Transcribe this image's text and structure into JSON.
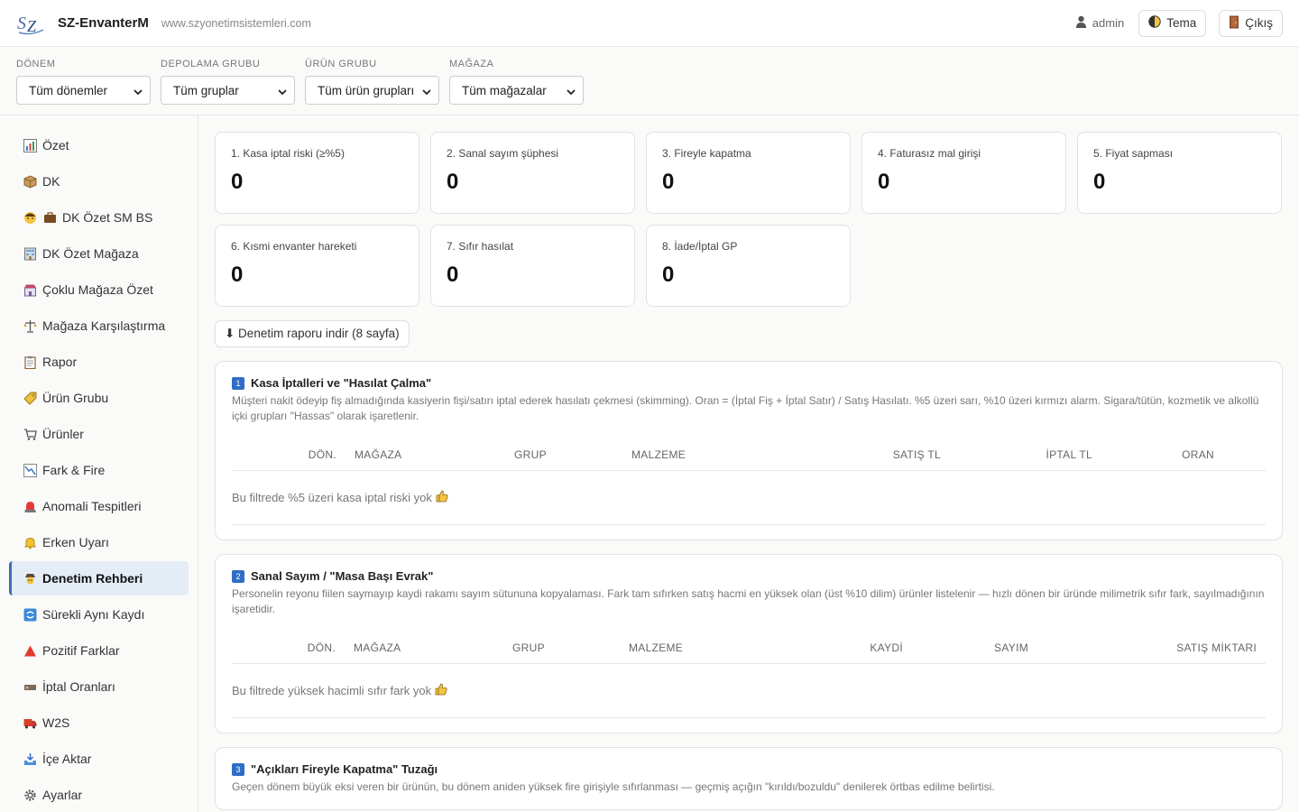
{
  "header": {
    "app_title": "SZ-EnvanterM",
    "site_url": "www.szyonetimsistemleri.com",
    "user": "admin",
    "theme_label": "Tema",
    "logout_label": "Çıkış"
  },
  "filters": [
    {
      "label": "DÖNEM",
      "value": "Tüm dönemler"
    },
    {
      "label": "DEPOLAMA GRUBU",
      "value": "Tüm gruplar"
    },
    {
      "label": "ÜRÜN GRUBU",
      "value": "Tüm ürün grupları"
    },
    {
      "label": "MAĞAZA",
      "value": "Tüm mağazalar"
    }
  ],
  "sidebar": {
    "items": [
      {
        "label": "Özet",
        "icon": "bar-chart-icon"
      },
      {
        "label": "DK",
        "icon": "package-icon"
      },
      {
        "label": "DK Özet SM BS",
        "icon": "person-briefcase-icon"
      },
      {
        "label": "DK Özet Mağaza",
        "icon": "building-icon"
      },
      {
        "label": "Çoklu Mağaza Özet",
        "icon": "store-icon"
      },
      {
        "label": "Mağaza Karşılaştırma",
        "icon": "scales-icon"
      },
      {
        "label": "Rapor",
        "icon": "clipboard-icon"
      },
      {
        "label": "Ürün Grubu",
        "icon": "tag-icon"
      },
      {
        "label": "Ürünler",
        "icon": "cart-icon"
      },
      {
        "label": "Fark & Fire",
        "icon": "trend-icon"
      },
      {
        "label": "Anomali Tespitleri",
        "icon": "siren-icon"
      },
      {
        "label": "Erken Uyarı",
        "icon": "bell-icon"
      },
      {
        "label": "Denetim Rehberi",
        "icon": "detective-icon"
      },
      {
        "label": "Sürekli Aynı Kaydı",
        "icon": "repeat-icon"
      },
      {
        "label": "Pozitif Farklar",
        "icon": "triangle-icon"
      },
      {
        "label": "İptal Oranları",
        "icon": "cancel-icon"
      },
      {
        "label": "W2S",
        "icon": "truck-icon"
      },
      {
        "label": "İçe Aktar",
        "icon": "import-icon"
      },
      {
        "label": "Ayarlar",
        "icon": "gear-icon"
      }
    ],
    "active_index": 12
  },
  "cards": [
    {
      "title": "1. Kasa iptal riski (≥%5)",
      "value": "0"
    },
    {
      "title": "2. Sanal sayım şüphesi",
      "value": "0"
    },
    {
      "title": "3. Fireyle kapatma",
      "value": "0"
    },
    {
      "title": "4. Faturasız mal girişi",
      "value": "0"
    },
    {
      "title": "5. Fiyat sapması",
      "value": "0"
    },
    {
      "title": "6. Kısmi envanter hareketi",
      "value": "0"
    },
    {
      "title": "7. Sıfır hasılat",
      "value": "0"
    },
    {
      "title": "8. İade/İptal GP",
      "value": "0"
    }
  ],
  "download_label": "⬇ Denetim raporu indir (8 sayfa)",
  "sections": [
    {
      "num": "1",
      "title": "Kasa İptalleri ve \"Hasılat Çalma\"",
      "desc": "Müşteri nakit ödeyip fiş almadığında kasiyerin fişi/satırı iptal ederek hasılatı çekmesi (skimming). Oran = (İptal Fiş + İptal Satır) / Satış Hasılatı. %5 üzeri sarı, %10 üzeri kırmızı alarm. Sigara/tütün, kozmetik ve alkollü içki grupları \"Hassas\" olarak işaretlenir.",
      "columns": [
        "DÖN.",
        "MAĞAZA",
        "GRUP",
        "MALZEME",
        "SATIŞ TL",
        "İPTAL TL",
        "ORAN"
      ],
      "empty": "Bu filtrede %5 üzeri kasa iptal riski yok"
    },
    {
      "num": "2",
      "title": "Sanal Sayım / \"Masa Başı Evrak\"",
      "desc": "Personelin reyonu fiilen saymayıp kaydi rakamı sayım sütununa kopyalaması. Fark tam sıfırken satış hacmi en yüksek olan (üst %10 dilim) ürünler listelenir — hızlı dönen bir üründe milimetrik sıfır fark, sayılmadığının işaretidir.",
      "columns": [
        "DÖN.",
        "MAĞAZA",
        "GRUP",
        "MALZEME",
        "KAYDİ",
        "SAYIM",
        "SATIŞ MİKTARI"
      ],
      "empty": "Bu filtrede yüksek hacimli sıfır fark yok"
    },
    {
      "num": "3",
      "title": "\"Açıkları Fireyle Kapatma\" Tuzağı",
      "desc": "Geçen dönem büyük eksi veren bir ürünün, bu dönem aniden yüksek fire girişiyle sıfırlanması — geçmiş açığın \"kırıldı/bozuldu\" denilerek örtbas edilme belirtisi."
    }
  ]
}
